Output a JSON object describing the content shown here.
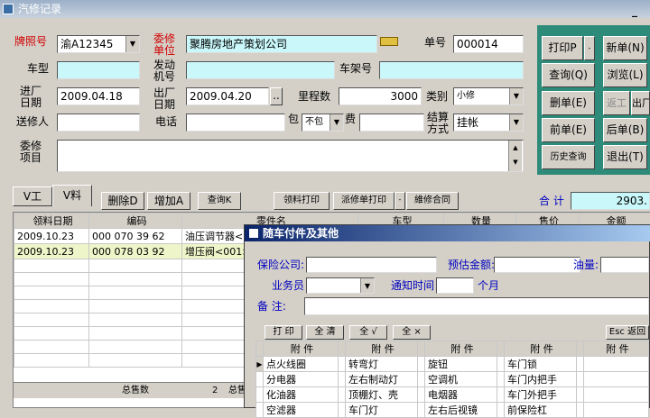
{
  "window": {
    "title": "汽修记录"
  },
  "form": {
    "plate_label": "牌照号",
    "plate_value": "渝A12345",
    "client_label": "委修单位",
    "client_value": "聚腾房地产策划公司",
    "order_label": "单号",
    "order_value": "000014",
    "model_label": "车型",
    "model_value": "",
    "engine_label": "发动机号",
    "engine_value": "",
    "vin_label": "车架号",
    "vin_value": "",
    "in_label": "进厂日期",
    "in_value": "2009.04.18",
    "out_label": "出厂日期",
    "out_value": "2009.04.20",
    "mileage_label": "里程数",
    "mileage_value": "3000",
    "type_label": "类别",
    "type_value": "小修",
    "sender_label": "送修人",
    "sender_value": "",
    "phone_label": "电话",
    "phone_value": "",
    "pkg_label": "包",
    "pkg_value": "不包",
    "fee_label": "费",
    "fee_value": "",
    "settle_label": "结算方式",
    "settle_value": "挂帐",
    "items_label": "委修项目",
    "items_value": ""
  },
  "right_buttons": {
    "print": "打印P",
    "new": "新单(N)",
    "query": "查询(Q)",
    "browse": "浏览(L)",
    "delete": "删单(E)",
    "rework": "返工",
    "out": "出厂",
    "prev": "前单(E)",
    "next": "后单(B)",
    "history": "历史查询",
    "exit": "退出(T)"
  },
  "toolbar": {
    "tab_labor": "V工",
    "tab_parts": "V料",
    "delete": "删除D",
    "add": "增加A",
    "query": "查询K",
    "material_print": "领料打印",
    "dispatch_print": "派修单打印",
    "repair_contract": "維修合同",
    "total_label": "合 计",
    "total_value": "2903."
  },
  "table": {
    "headers": [
      "领料日期",
      "编码",
      "零件名",
      "车型",
      "数量",
      "售价",
      "金额"
    ],
    "rows": [
      {
        "date": "2009.10.23",
        "code": "000 070 39 62",
        "name": "油压调节器<"
      },
      {
        "date": "2009.10.23",
        "code": "000 078 03 92",
        "name": "增压阀<001>"
      }
    ],
    "footer_label": "总售数",
    "footer_count": "2",
    "footer_label2": "总售"
  },
  "popup": {
    "title": "随车付件及其他",
    "insurance_label": "保险公司:",
    "insurance_value": "",
    "estimate_label": "预估金额:",
    "estimate_value": "",
    "oil_label": "油量:",
    "oil_value": "",
    "staff_label": "业务员",
    "staff_value": "",
    "notify_label": "通知时间",
    "notify_value": "",
    "month_label": "个月",
    "remark_label": "备 注:",
    "remark_value": "",
    "btn_print": "打 印",
    "btn_clear": "全 清",
    "btn_all_check": "全 √",
    "btn_all_x": "全 ×",
    "btn_esc": "Esc 返回",
    "col_header": "附 件",
    "rows": [
      [
        "点火线圈",
        "转弯灯",
        "旋钮",
        "车门锁",
        ""
      ],
      [
        "分电器",
        "左右制动灯",
        "空调机",
        "车门内把手",
        ""
      ],
      [
        "化油器",
        "顶棚灯、壳",
        "电烟器",
        "车门外把手",
        ""
      ],
      [
        "空滤器",
        "车门灯",
        "左右后视镜",
        "前保险杠",
        ""
      ]
    ]
  }
}
